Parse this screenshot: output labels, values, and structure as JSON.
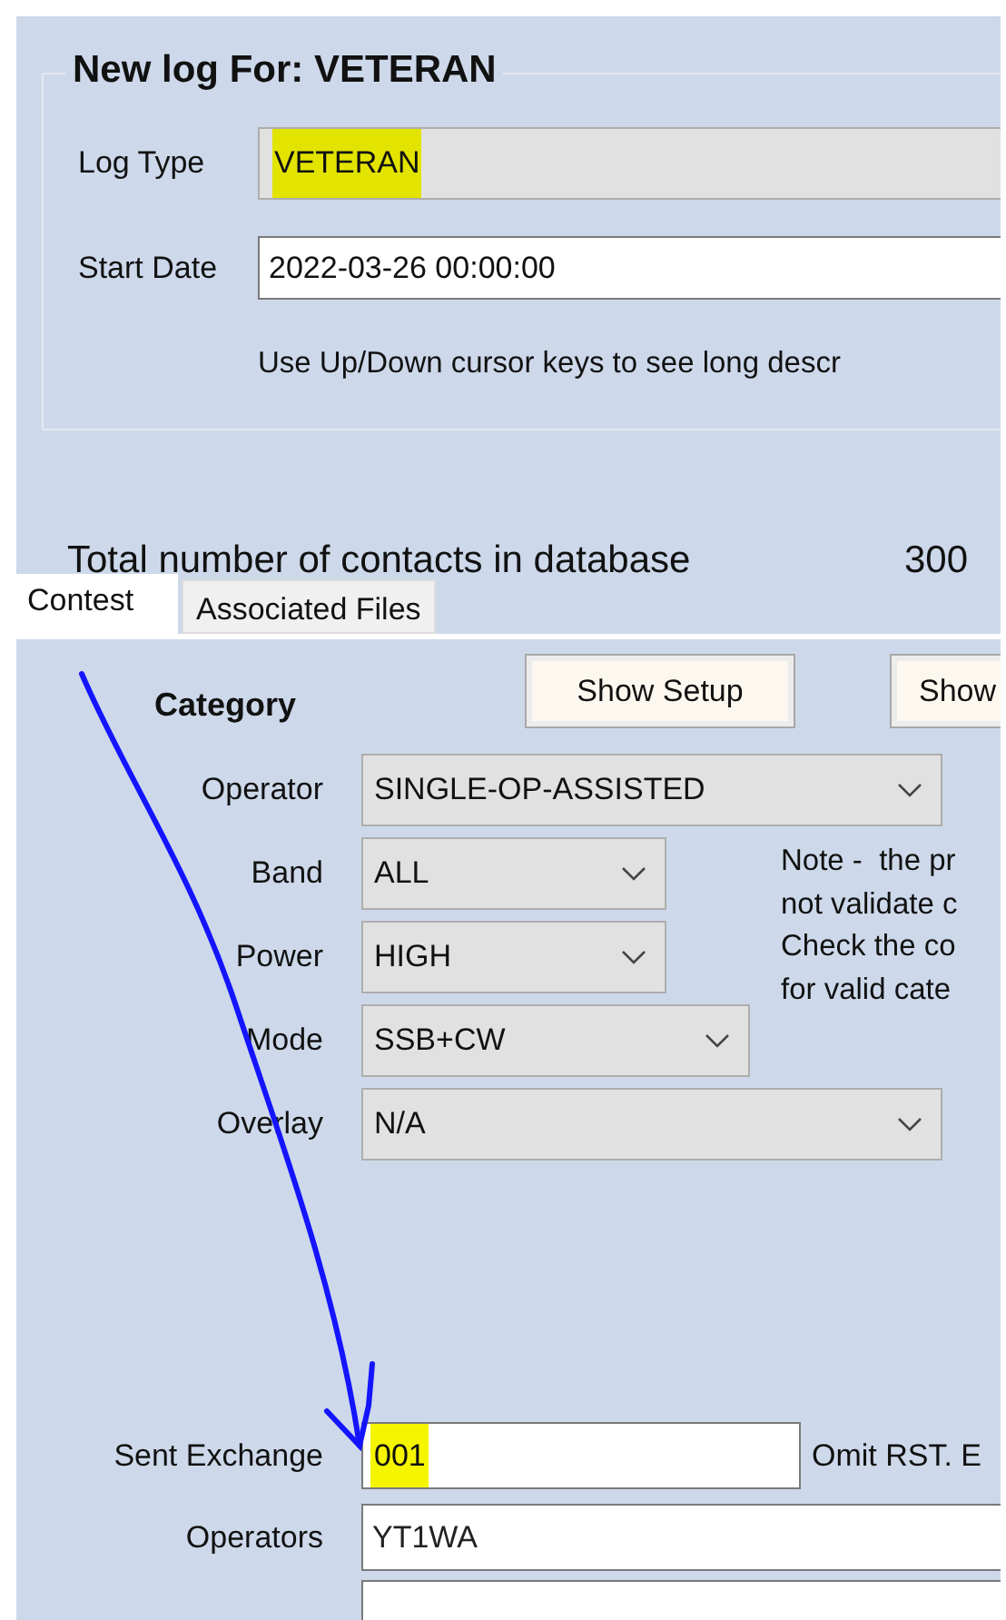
{
  "log_form": {
    "title": "New log For: VETERAN",
    "log_type": {
      "label": "Log Type",
      "value": "VETERAN",
      "highlighted": true
    },
    "start_date": {
      "label": "Start Date",
      "value": "2022-03-26 00:00:00"
    },
    "hint": "Use Up/Down cursor keys to see long descr"
  },
  "total_contacts": {
    "label": "Total number of contacts in database",
    "value": "300"
  },
  "tabs": [
    {
      "label": "Contest",
      "selected": true
    },
    {
      "label": "Associated Files",
      "selected": false
    }
  ],
  "category": {
    "title": "Category",
    "buttons": [
      "Show Setup",
      "Show"
    ],
    "fields": [
      {
        "label": "Operator",
        "value": "SINGLE-OP-ASSISTED"
      },
      {
        "label": "Band",
        "value": "ALL"
      },
      {
        "label": "Power",
        "value": "HIGH"
      },
      {
        "label": "Mode",
        "value": "SSB+CW"
      },
      {
        "label": "Overlay",
        "value": "N/A"
      }
    ],
    "note": [
      "Note -  the pr",
      "not validate c",
      "Check the co",
      "for valid cate"
    ]
  },
  "sent_exchange": {
    "label": "Sent Exchange",
    "value": "001",
    "highlighted": true,
    "note": "Omit RST. E"
  },
  "operators": {
    "label": "Operators",
    "value": "YT1WA"
  }
}
